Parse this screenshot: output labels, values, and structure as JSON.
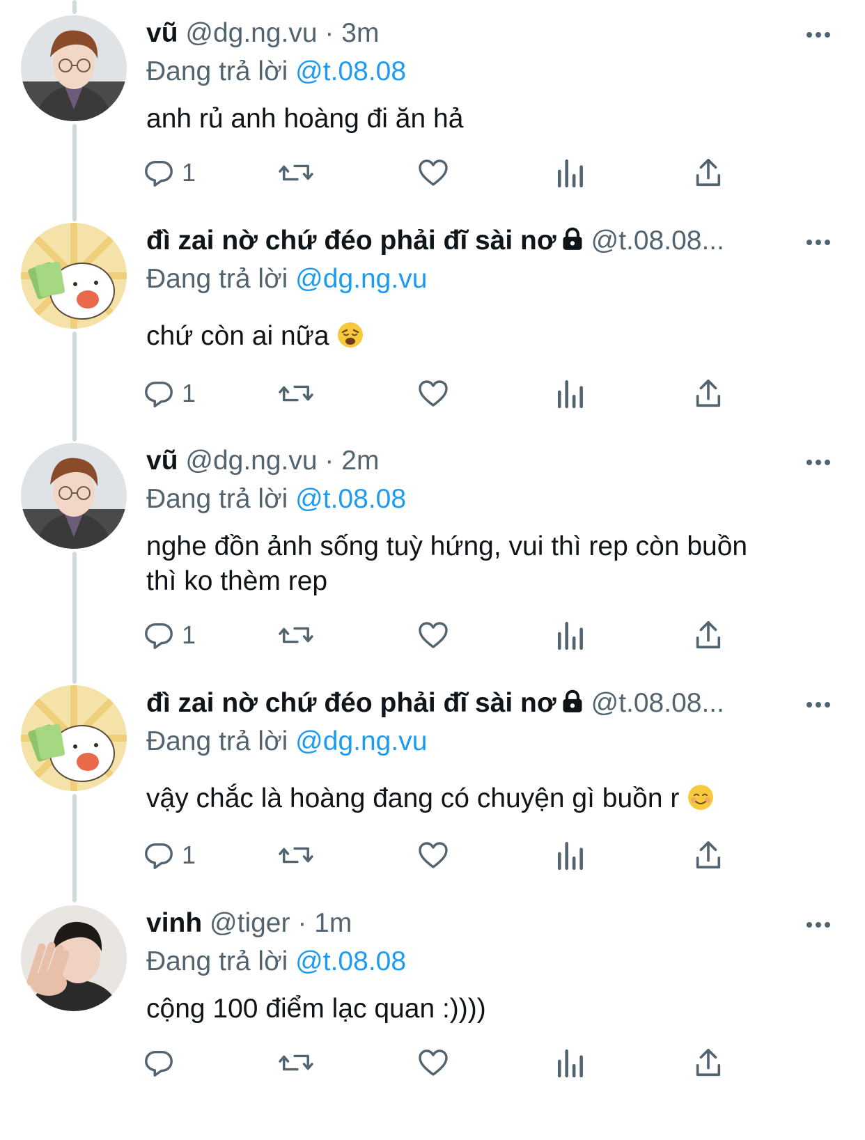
{
  "colors": {
    "link": "#1d9bf0",
    "secondary_text": "#536471",
    "primary_text": "#0f1419",
    "thread_line": "#cfd9de"
  },
  "tweets": [
    {
      "display_name": "vũ",
      "handle": "@dg.ng.vu",
      "separator": "·",
      "time": "3m",
      "reply_prefix": "Đang trả lời",
      "reply_to": "@t.08.08",
      "text": "anh rủ anh hoàng đi ăn hả",
      "reply_count": "1",
      "avatar": "photo-young-man-glasses"
    },
    {
      "display_name": "đì zai nờ chứ đéo phải đĩ sài nơ",
      "handle": "@t.08.08...",
      "reply_prefix": "Đang trả lời",
      "reply_to": "@dg.ng.vu",
      "text": "chứ còn ai nữa",
      "emoji": "weary-face-emoji",
      "reply_count": "1",
      "avatar": "cartoon-cat-with-money",
      "locked": true
    },
    {
      "display_name": "vũ",
      "handle": "@dg.ng.vu",
      "separator": "·",
      "time": "2m",
      "reply_prefix": "Đang trả lời",
      "reply_to": "@t.08.08",
      "text_line1": "nghe đồn ảnh sống tuỳ hứng, vui thì rep còn buồn",
      "text_line2": "thì ko thèm rep",
      "reply_count": "1",
      "avatar": "photo-young-man-glasses"
    },
    {
      "display_name": "đì zai nờ chứ đéo phải đĩ sài nơ",
      "handle": "@t.08.08...",
      "reply_prefix": "Đang trả lời",
      "reply_to": "@dg.ng.vu",
      "text": "vậy chắc là hoàng đang có chuyện gì buồn r",
      "emoji": "smiling-face-emoji",
      "reply_count": "1",
      "avatar": "cartoon-cat-with-money",
      "locked": true
    },
    {
      "display_name": "vinh",
      "handle": "@tiger",
      "separator": "·",
      "time": "1m",
      "reply_prefix": "Đang trả lời",
      "reply_to": "@t.08.08",
      "text": "cộng 100 điểm lạc quan :))))",
      "reply_count": "",
      "avatar": "photo-young-man-hand"
    }
  ],
  "icons": {
    "reply": "reply-icon",
    "retweet": "retweet-icon",
    "like": "heart-icon",
    "views": "views-icon",
    "share": "share-icon",
    "more": "more-icon",
    "lock": "lock-icon"
  }
}
